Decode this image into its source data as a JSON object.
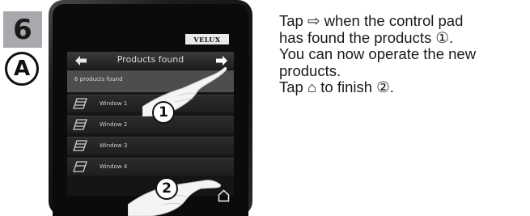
{
  "step": {
    "number": "6",
    "variant": "A"
  },
  "device": {
    "brand": "VELUX",
    "screen": {
      "title": "Products found",
      "count_text": "6 products found",
      "items": [
        {
          "label": "Window 1",
          "icon": "window-icon"
        },
        {
          "label": "Window 2",
          "icon": "window-icon"
        },
        {
          "label": "Window 3",
          "icon": "window-icon"
        },
        {
          "label": "Window 4",
          "icon": "window-icon"
        }
      ]
    }
  },
  "callouts": {
    "first": "1",
    "second": "2"
  },
  "instructions": {
    "line1": "Tap ⇨ when the control pad",
    "line2": "has found the products ①.",
    "line3": "You can now operate the new",
    "line4": "products.",
    "line5": "Tap ⌂ to finish ②."
  },
  "colors": {
    "badge": "#a7a9ac",
    "device": "#111111",
    "screen_row": "#4d4d4d",
    "text": "#1a1a1a"
  }
}
